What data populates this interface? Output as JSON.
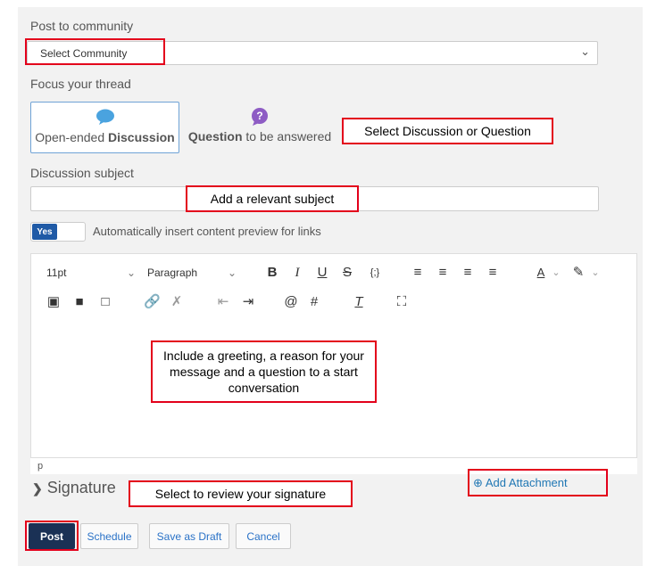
{
  "form": {
    "post_to_label": "Post to community",
    "community_select_value": "Select Community",
    "focus_label": "Focus your thread",
    "focus_discussion_pre": "Open-ended ",
    "focus_discussion_bold": "Discussion",
    "focus_question_bold": "Question",
    "focus_question_post": " to be answered",
    "subject_label": "Discussion subject",
    "toggle_value": "Yes",
    "toggle_text": "Automatically insert content preview for links",
    "signature_label": "Signature",
    "add_attachment_label": "Add Attachment"
  },
  "editor": {
    "font_size": "11pt",
    "block_format": "Paragraph",
    "status_path": "p",
    "toolbar_icons": [
      "bold",
      "italic",
      "underline",
      "strikethrough",
      "code",
      "align-left",
      "align-center",
      "align-right",
      "justify",
      "font-color",
      "highlight",
      "image",
      "video",
      "media",
      "link",
      "unlink",
      "outdent",
      "indent",
      "mention",
      "hashtag",
      "clear-format",
      "fullscreen"
    ]
  },
  "buttons": {
    "post": "Post",
    "schedule": "Schedule",
    "save_draft": "Save as Draft",
    "cancel": "Cancel"
  },
  "callouts": {
    "focus": "Select Discussion or Question",
    "subject": "Add a relevant subject",
    "body": "Include a greeting, a reason for your message and a question to a start conversation",
    "signature": "Select to review your signature"
  },
  "colors": {
    "accent": "#1f5aa6",
    "post_button": "#1a3155",
    "link": "#2a72c7",
    "highlight_border": "#e3001b",
    "discussion_icon": "#4aa3df",
    "question_icon": "#8e5cc4"
  }
}
